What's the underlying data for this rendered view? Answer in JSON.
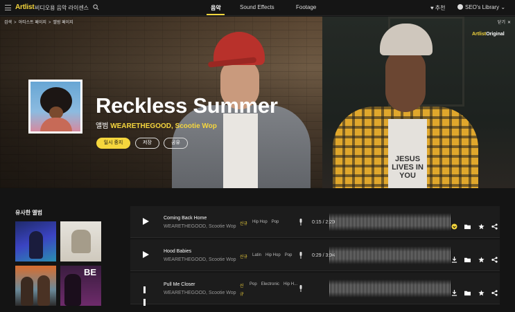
{
  "topbar": {
    "logo": "Artlist",
    "tagline": "비디오용 음악 라이센스",
    "tabs": [
      {
        "label": "음악",
        "active": true
      },
      {
        "label": "Sound Effects",
        "active": false
      },
      {
        "label": "Footage",
        "active": false
      }
    ],
    "recommend_label": "추천",
    "library_label": "SEO's Library"
  },
  "hero": {
    "breadcrumb": [
      "검색",
      "아티스트 페이지",
      "앨범 페이지"
    ],
    "close_label": "닫기",
    "original_brand": "Artlist",
    "original_word": "Original",
    "title": "Reckless Summer",
    "subtitle_prefix": "앨범",
    "subtitle_artists": "WEARETHEGOOD, Scootie Wop",
    "buttons": {
      "pause": "일시 중지",
      "save": "저장",
      "share": "공유"
    },
    "shirt_text": "JESUS LIVES IN YOU"
  },
  "similar": {
    "title": "유사한 앨범",
    "album4_text": "BE"
  },
  "tracks": [
    {
      "name": "Coming Back Home",
      "artists": "WEARETHEGOOD, Scootie Wop",
      "new_label": "신규",
      "genres": [
        "Hip Hop",
        "Pop"
      ],
      "time": "0:15 / 2:20",
      "playing": false
    },
    {
      "name": "Hood Babies",
      "artists": "WEARETHEGOOD, Scootie Wop",
      "new_label": "신규",
      "genres": [
        "Latin",
        "Hip Hop",
        "Pop"
      ],
      "time": "0:29 / 3:04",
      "playing": false
    },
    {
      "name": "Pull Me Closer",
      "artists": "WEARETHEGOOD, Scootie Wop",
      "new_label": "신규",
      "genres": [
        "Pop",
        "Electronic",
        "Hip H..."
      ],
      "time": "",
      "playing": true
    }
  ],
  "colors": {
    "accent": "#f5d63d",
    "background": "#141414",
    "row": "#1c1c1c"
  }
}
